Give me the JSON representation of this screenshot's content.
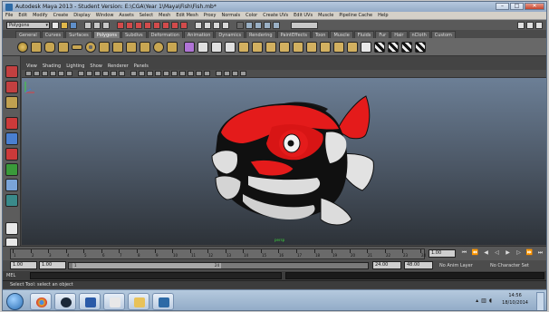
{
  "window": {
    "title": "Autodesk Maya 2013 - Student Version: E:\\CGA\\Year 1\\Maya\\Fish\\Fish.mb*",
    "minimize_icon": "minimize-icon",
    "maximize_icon": "maximize-icon",
    "close_icon": "close-icon"
  },
  "menubar": {
    "items": [
      "File",
      "Edit",
      "Modify",
      "Create",
      "Display",
      "Window",
      "Assets",
      "Select",
      "Mesh",
      "Edit Mesh",
      "Proxy",
      "Normals",
      "Color",
      "Create UVs",
      "Edit UVs",
      "Muscle",
      "Pipeline Cache",
      "Help"
    ]
  },
  "statusline": {
    "mode": "Polygons"
  },
  "shelf": {
    "tabs": [
      "General",
      "Curves",
      "Surfaces",
      "Polygons",
      "Subdivs",
      "Deformation",
      "Animation",
      "Dynamics",
      "Rendering",
      "PaintEffects",
      "Toon",
      "Muscle",
      "Fluids",
      "Fur",
      "Hair",
      "nCloth",
      "Custom"
    ],
    "active_tab": "Polygons"
  },
  "panel": {
    "menu": [
      "View",
      "Shading",
      "Lighting",
      "Show",
      "Renderer",
      "Panels"
    ],
    "camera_label": "persp"
  },
  "timeline": {
    "ticks": [
      "1",
      "2",
      "3",
      "4",
      "5",
      "6",
      "7",
      "8",
      "9",
      "10",
      "11",
      "12",
      "13",
      "14",
      "15",
      "16",
      "17",
      "18",
      "19",
      "20",
      "21",
      "22",
      "23",
      "24"
    ],
    "current_frame": "1.00",
    "playback_icons": [
      "go-to-start-icon",
      "step-back-key-icon",
      "step-back-frame-icon",
      "play-back-icon",
      "play-forward-icon",
      "step-forward-frame-icon",
      "step-forward-key-icon",
      "go-to-end-icon"
    ]
  },
  "range": {
    "start": "1.00",
    "playback_start": "1.00",
    "slider_start": "1",
    "slider_end": "24",
    "playback_end": "24.00",
    "end": "48.00",
    "anim_layer": "No Anim Layer",
    "character_set": "No Character Set"
  },
  "command": {
    "mel_label": "MEL"
  },
  "help": {
    "text": "Select Tool: select an object"
  },
  "taskbar": {
    "time": "14:56",
    "date": "18/10/2014"
  },
  "colors": {
    "fish_red": "#e41b1b",
    "fish_white": "#e2e2e2",
    "fish_black": "#101010"
  }
}
